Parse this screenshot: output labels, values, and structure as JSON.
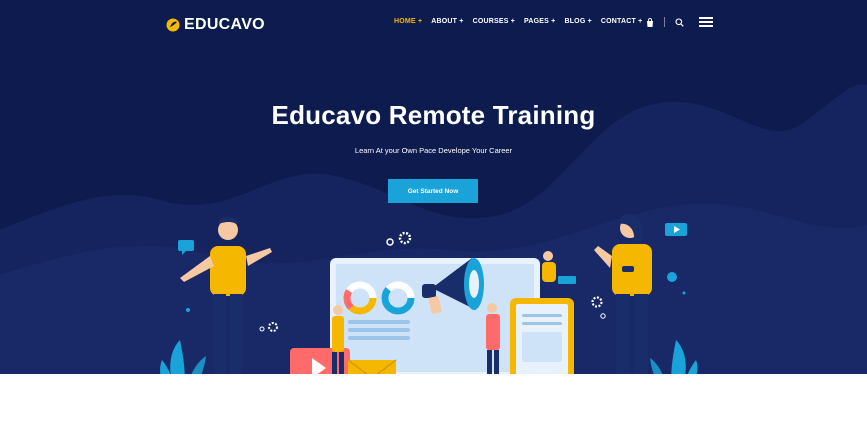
{
  "brand": {
    "name": "EDUCAVO"
  },
  "nav": {
    "items": [
      {
        "label": "HOME +",
        "active": true
      },
      {
        "label": "ABOUT +",
        "active": false
      },
      {
        "label": "COURSES +",
        "active": false
      },
      {
        "label": "PAGES +",
        "active": false
      },
      {
        "label": "BLOG +",
        "active": false
      },
      {
        "label": "CONTACT +",
        "active": false
      }
    ],
    "icons": [
      "bag-icon",
      "search-icon",
      "menu-icon"
    ]
  },
  "hero": {
    "title": "Educavo Remote Training",
    "subtitle": "Learn At your Own Pace Develope Your Career",
    "cta_label": "Get Started Now"
  },
  "colors": {
    "hero_bg": "#0d1b4f",
    "accent": "#f5b700",
    "button": "#1aa3d8"
  }
}
